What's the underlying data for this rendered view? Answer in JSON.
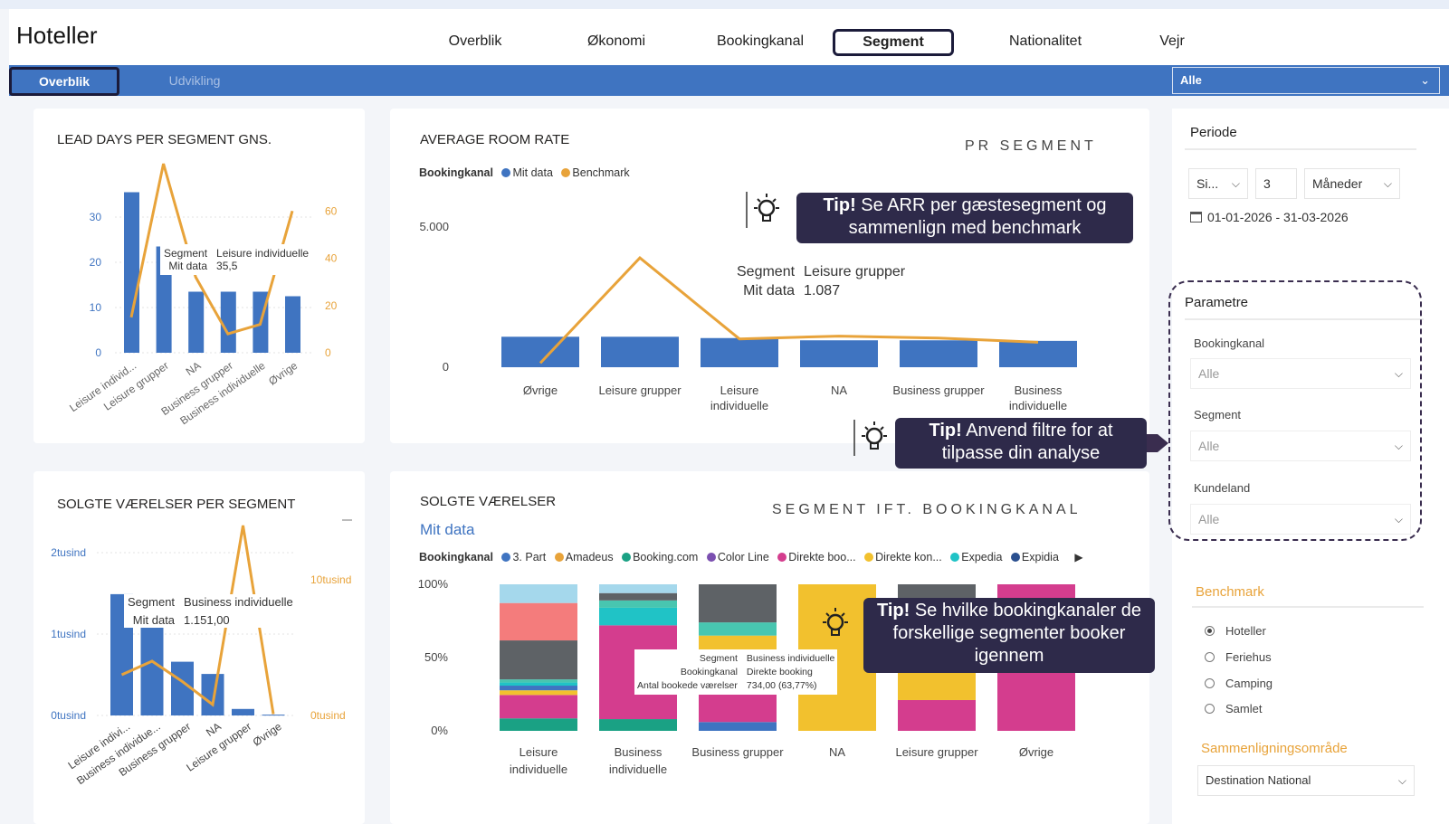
{
  "app": {
    "title": "Hoteller",
    "nav_tabs": [
      "Overblik",
      "Økonomi",
      "Bookingkanal",
      "Segment",
      "Nationalitet",
      "Vejr"
    ],
    "active_tab": "Segment",
    "sub_tabs": [
      "Overblik",
      "Udvikling"
    ],
    "active_sub_tab": "Overblik",
    "top_slicer_value": "Alle"
  },
  "cards": {
    "lead_days": {
      "title": "LEAD DAYS PER SEGMENT GNS.",
      "tooltip": {
        "k1": "Segment",
        "v1": "Leisure individuelle",
        "k2": "Mit data",
        "v2": "35,5"
      }
    },
    "arr": {
      "title": "AVERAGE ROOM RATE",
      "subtitle": "PR SEGMENT",
      "legend_label": "Bookingkanal",
      "legend": [
        {
          "name": "Mit data",
          "color": "#3f74c1"
        },
        {
          "name": "Benchmark",
          "color": "#e8a33a"
        }
      ],
      "tooltip": {
        "k1": "Segment",
        "v1": "Leisure grupper",
        "k2": "Mit data",
        "v2": "1.087"
      }
    },
    "solgte_per_segment": {
      "title": "SOLGTE VÆRELSER PER SEGMENT",
      "tooltip": {
        "k1": "Segment",
        "v1": "Business individuelle",
        "k2": "Mit data",
        "v2": "1.151,00"
      }
    },
    "solgte": {
      "title": "SOLGTE VÆRELSER",
      "subtitle_link": "Mit data",
      "right_title": "SEGMENT IFT. BOOKINGKANAL",
      "legend_label": "Bookingkanal",
      "legend": [
        {
          "name": "3. Part",
          "color": "#3f74c1"
        },
        {
          "name": "Amadeus",
          "color": "#e8a33a"
        },
        {
          "name": "Booking.com",
          "color": "#1aa184"
        },
        {
          "name": "Color Line",
          "color": "#7b4fb0"
        },
        {
          "name": "Direkte boo...",
          "color": "#d43d8e"
        },
        {
          "name": "Direkte kon...",
          "color": "#f2c12e"
        },
        {
          "name": "Expedia",
          "color": "#20c3c6"
        },
        {
          "name": "Expidia",
          "color": "#2a4f8f"
        }
      ],
      "tooltip": {
        "k1": "Segment",
        "v1": "Business individuelle",
        "k2": "Bookingkanal",
        "v2": "Direkte booking",
        "k3": "Antal bookede værelser",
        "v3": "734,00 (63,77%)"
      }
    }
  },
  "tips": {
    "arr": {
      "bold": "Tip!",
      "text": " Se ARR per gæstesegment og sammenlign med benchmark"
    },
    "filters": {
      "bold": "Tip!",
      "text": " Anvend filtre for at tilpasse din analyse"
    },
    "channels": {
      "bold": "Tip!",
      "text": " Se hvilke bookingkanaler de forskellige segmenter booker igennem"
    }
  },
  "panel": {
    "periode_label": "Periode",
    "period_mode": "Si...",
    "period_count": "3",
    "period_unit": "Måneder",
    "date_range": "01-01-2026 - 31-03-2026",
    "parametre_label": "Parametre",
    "bookingkanal_label": "Bookingkanal",
    "bookingkanal_value": "Alle",
    "segment_label": "Segment",
    "segment_value": "Alle",
    "kundeland_label": "Kundeland",
    "kundeland_value": "Alle",
    "benchmark_label": "Benchmark",
    "benchmark_options": [
      "Hoteller",
      "Feriehus",
      "Camping",
      "Samlet"
    ],
    "benchmark_selected": "Hoteller",
    "compare_label": "Sammenligningsområde",
    "compare_value": "Destination National"
  },
  "chart_data": [
    {
      "type": "bar",
      "id": "lead_days",
      "title": "LEAD DAYS PER SEGMENT GNS.",
      "categories": [
        "Leisure individ...",
        "Leisure grupper",
        "NA",
        "Business grupper",
        "Business individuelle",
        "Øvrige"
      ],
      "series": [
        {
          "name": "Mit data",
          "axis": "left",
          "values": [
            35.5,
            23.5,
            13.5,
            13.5,
            13.5,
            12.5
          ]
        },
        {
          "name": "Benchmark",
          "axis": "right",
          "kind": "line",
          "values": [
            15,
            80,
            32,
            8,
            12,
            60
          ],
          "x_offsets": [
            0,
            1,
            2,
            3,
            4,
            5
          ]
        }
      ],
      "y_ticks_left": [
        "0",
        "10",
        "20",
        "30"
      ],
      "y_ticks_right": [
        "0",
        "20",
        "40",
        "60"
      ]
    },
    {
      "type": "bar",
      "id": "arr",
      "title": "AVERAGE ROOM RATE",
      "categories": [
        "Øvrige",
        "Leisure grupper",
        "Leisure individuelle",
        "NA",
        "Business grupper",
        "Business individuelle"
      ],
      "series": [
        {
          "name": "Mit data",
          "values": [
            1087,
            1087,
            1040,
            960,
            960,
            940
          ]
        },
        {
          "name": "Benchmark",
          "kind": "line",
          "values": [
            150,
            3900,
            1010,
            1110,
            1040,
            890
          ]
        }
      ],
      "y_ticks": [
        "0",
        "5.000"
      ]
    },
    {
      "type": "bar",
      "id": "solgte_per_segment",
      "title": "SOLGTE VÆRELSER PER SEGMENT",
      "categories": [
        "Leisure indivi...",
        "Business individue...",
        "Business grupper",
        "NA",
        "Leisure grupper",
        "Øvrige"
      ],
      "series": [
        {
          "name": "Mit data",
          "axis": "left",
          "values": [
            1490,
            1151,
            660,
            510,
            80,
            10
          ]
        },
        {
          "name": "Benchmark",
          "axis": "right",
          "kind": "line",
          "values": [
            3000,
            4000,
            2500,
            800,
            14000,
            100
          ]
        }
      ],
      "y_ticks_left": [
        "0tusind",
        "1tusind",
        "2tusind"
      ],
      "y_ticks_right": [
        "0tusind",
        "10tusind"
      ]
    },
    {
      "type": "bar",
      "id": "solgte_stacked",
      "stacked": "100%",
      "title": "SOLGTE VÆRELSER",
      "categories": [
        "Leisure individuelle",
        "Business individuelle",
        "Business grupper",
        "NA",
        "Leisure grupper",
        "Øvrige"
      ],
      "y_ticks": [
        "0%",
        "50%",
        "100%"
      ],
      "stacks": [
        [
          [
            "#1aa184",
            8
          ],
          [
            "#d43d8e",
            15
          ],
          [
            "#f2c12e",
            3
          ],
          [
            "#3f74c1",
            3
          ],
          [
            "#20c3c6",
            2
          ],
          [
            "#48c6b0",
            2
          ],
          [
            "#5e6266",
            25
          ],
          [
            "#f47c7c",
            24
          ],
          [
            "#a5d8ec",
            12
          ]
        ],
        [
          [
            "#1aa184",
            8
          ],
          [
            "#d43d8e",
            64
          ],
          [
            "#20c3c6",
            12
          ],
          [
            "#48c6b0",
            5
          ],
          [
            "#5e6266",
            5
          ],
          [
            "#a5d8ec",
            6
          ]
        ],
        [
          [
            "#3f74c1",
            6
          ],
          [
            "#d43d8e",
            20
          ],
          [
            "#f2c12e",
            39
          ],
          [
            "#48c6b0",
            9
          ],
          [
            "#5e6266",
            26
          ]
        ],
        [
          [
            "#f2c12e",
            100
          ]
        ],
        [
          [
            "#d43d8e",
            21
          ],
          [
            "#f2c12e",
            36
          ],
          [
            "#20c3c6",
            30
          ],
          [
            "#5e6266",
            13
          ]
        ],
        [
          [
            "#d43d8e",
            100
          ]
        ]
      ]
    }
  ]
}
